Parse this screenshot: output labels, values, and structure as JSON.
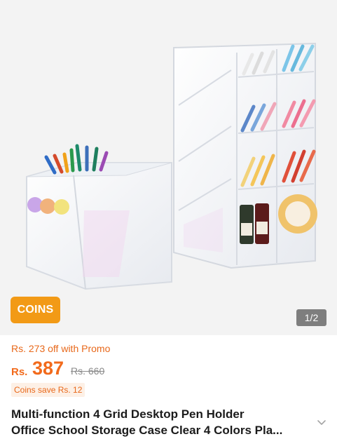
{
  "gallery": {
    "badge_label": "COINS",
    "page_indicator": "1/2"
  },
  "pricing": {
    "promo_text": "Rs. 273 off with Promo",
    "currency": "Rs.",
    "price": "387",
    "original_price": "Rs. 660",
    "coins_save": "Coins save Rs. 12"
  },
  "product": {
    "title_line1": "Multi-function 4 Grid Desktop Pen Holder",
    "title_line2": "Office School Storage Case Clear 4 Colors Pla..."
  },
  "icons": {
    "expand": "chevron-down-icon"
  },
  "colors": {
    "accent": "#f26a1b",
    "badge": "#f29a16",
    "gallery_bg": "#f3f3f3"
  }
}
